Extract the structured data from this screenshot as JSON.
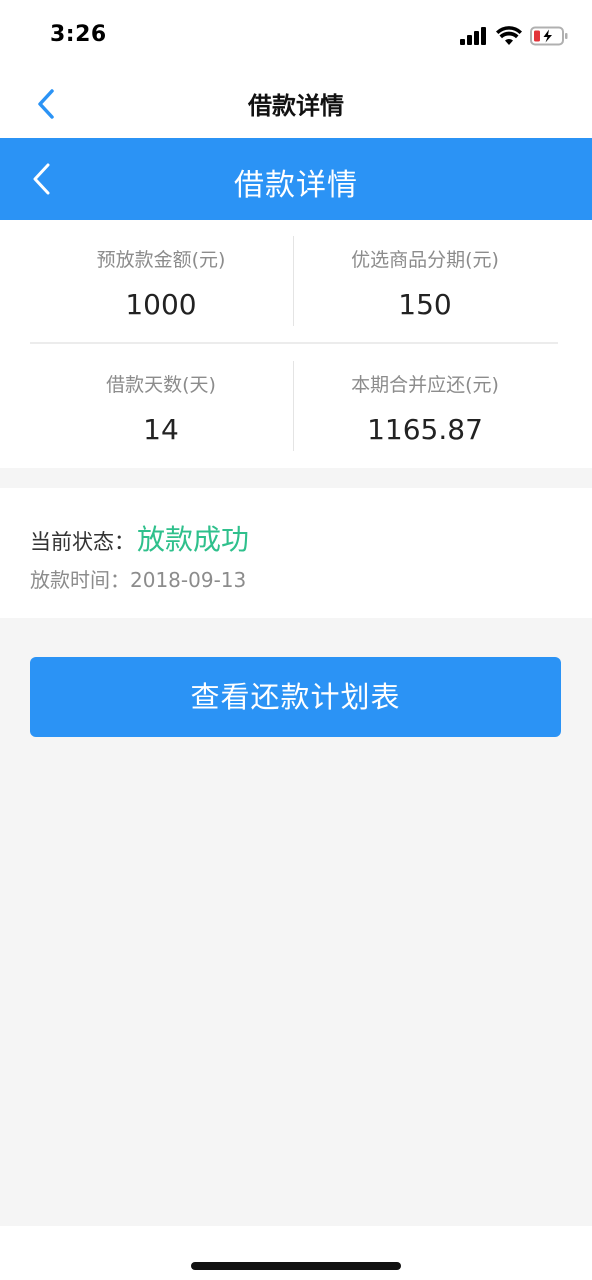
{
  "status_bar": {
    "time": "3:26"
  },
  "native_nav": {
    "title": "借款详情"
  },
  "header": {
    "title": "借款详情"
  },
  "stats": [
    {
      "label": "预放款金额(元)",
      "value": "1000"
    },
    {
      "label": "优选商品分期(元)",
      "value": "150"
    },
    {
      "label": "借款天数(天)",
      "value": "14"
    },
    {
      "label": "本期合并应还(元)",
      "value": "1165.87"
    }
  ],
  "loan_status": {
    "label": "当前状态：",
    "value": "放款成功",
    "time_label": "放款时间：",
    "time_value": "2018-09-13"
  },
  "actions": {
    "view_plan_label": "查看还款计划表"
  },
  "colors": {
    "primary": "#2b93f5",
    "success": "#2fc08c",
    "muted_text": "#8c8c8c",
    "background": "#f5f5f5"
  },
  "icons": {
    "signal": "cellular-signal-icon",
    "wifi": "wifi-icon",
    "battery": "battery-charging-icon",
    "back": "chevron-left-icon"
  }
}
